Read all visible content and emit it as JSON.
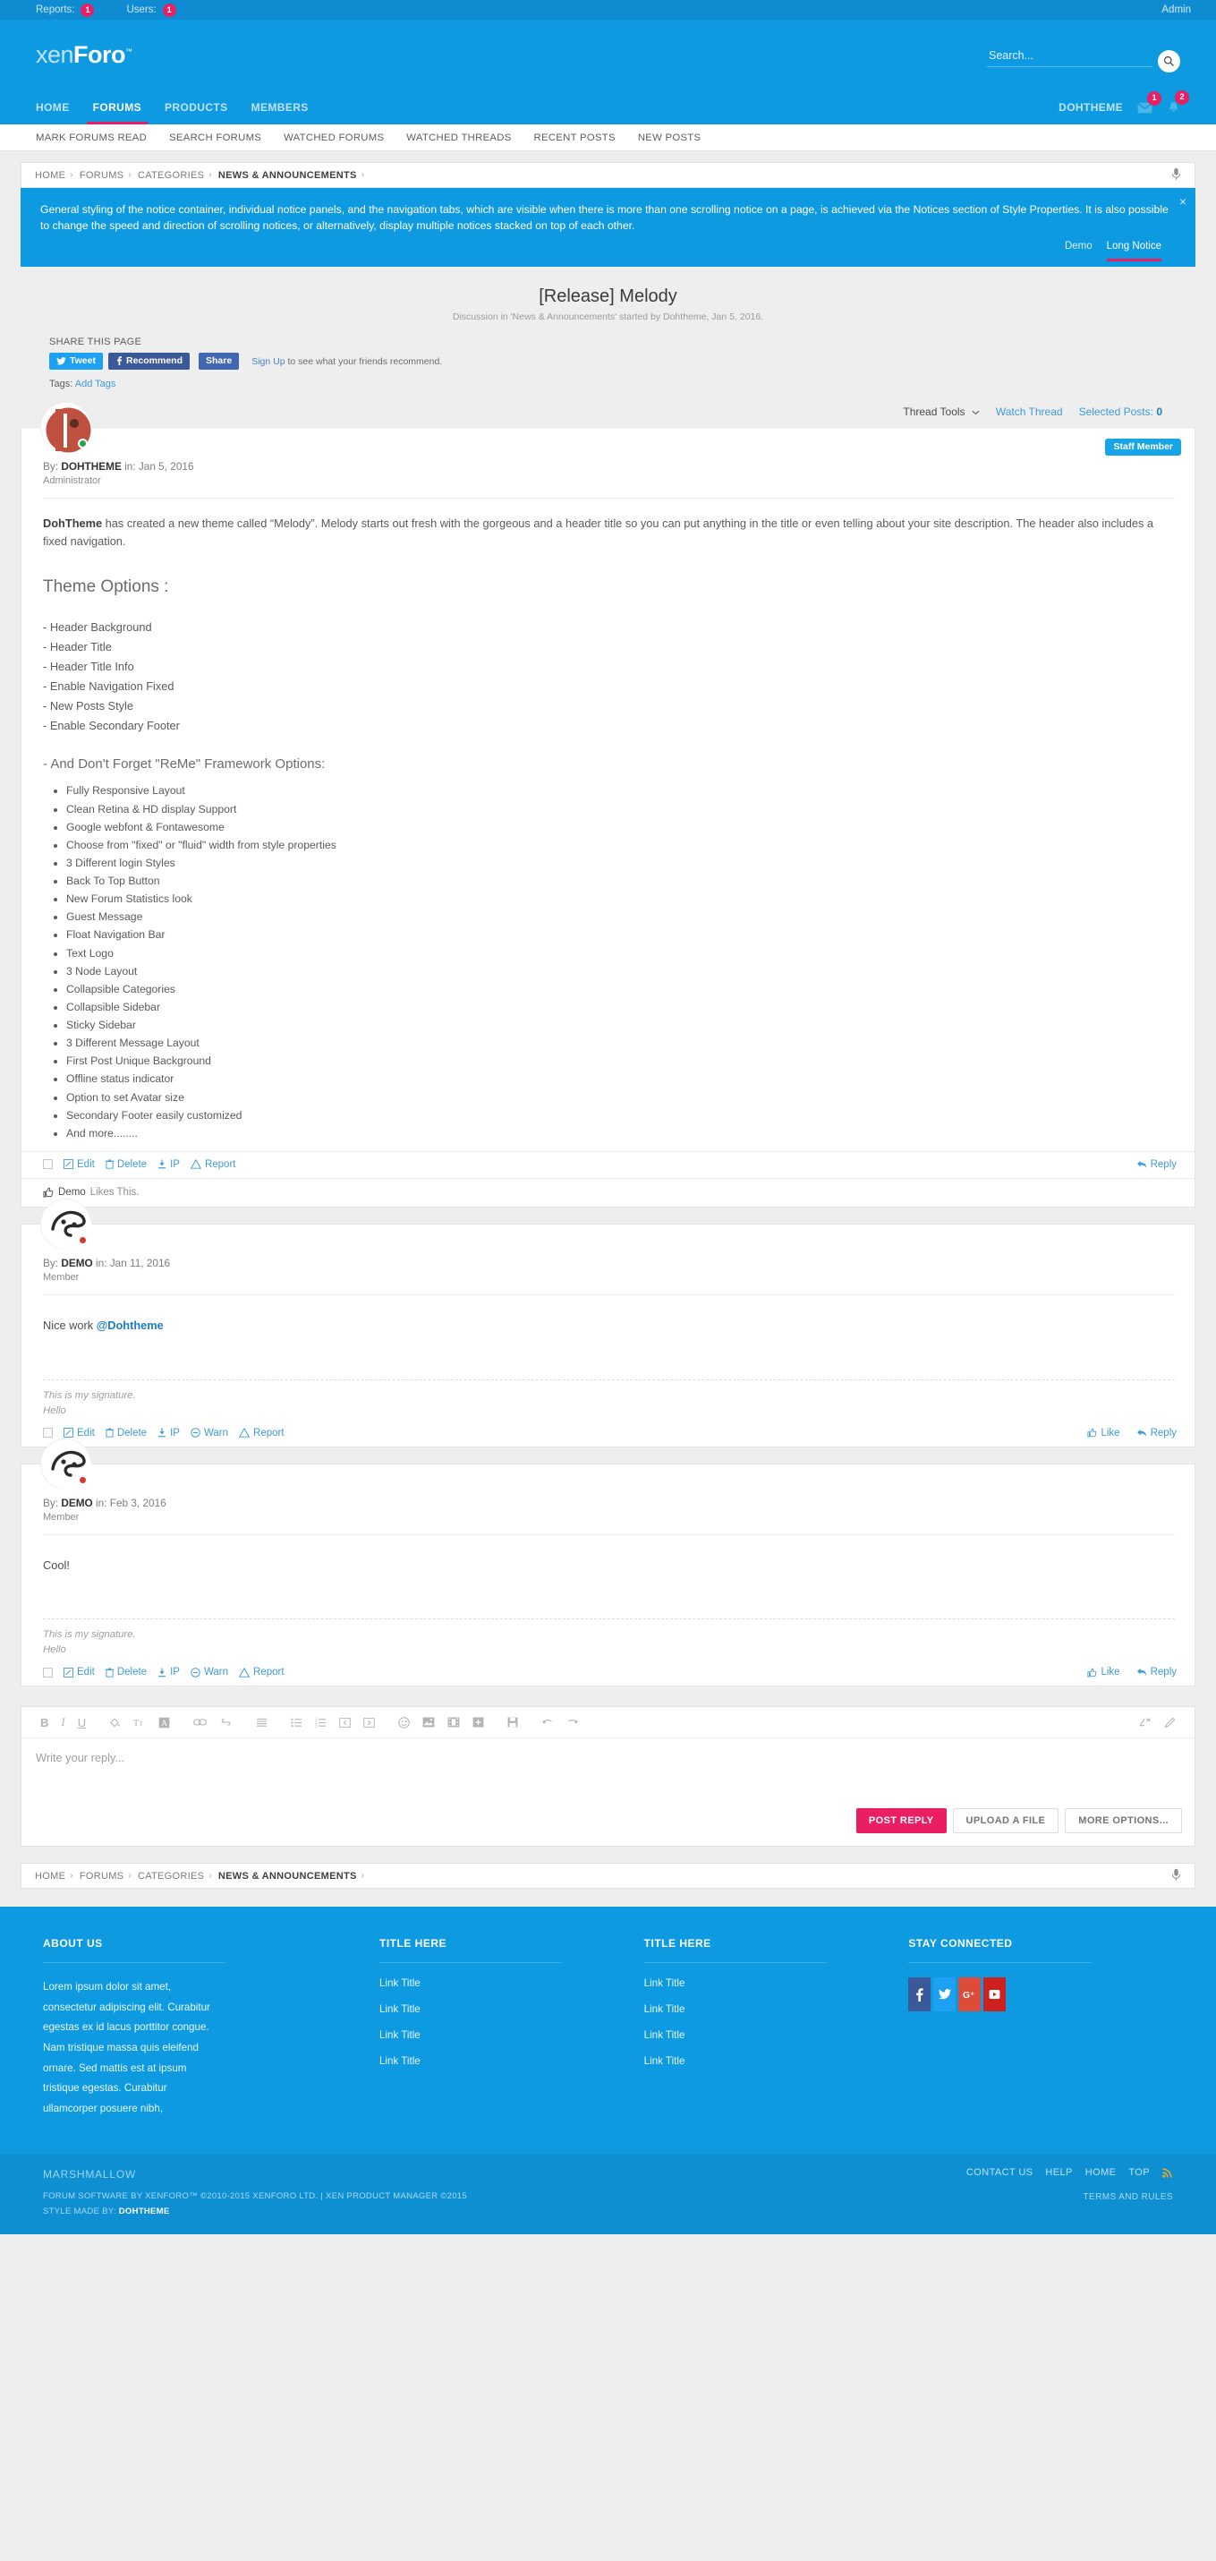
{
  "admin_bar": {
    "reports_label": "Reports:",
    "reports_count": "1",
    "users_label": "Users:",
    "users_count": "1",
    "admin_link": "Admin"
  },
  "header": {
    "logo_thin": "xen",
    "logo_bold": "Foro",
    "logo_tm": "™",
    "search_placeholder": "Search..."
  },
  "nav": {
    "tabs": [
      {
        "label": "HOME",
        "active": false
      },
      {
        "label": "FORUMS",
        "active": true
      },
      {
        "label": "PRODUCTS",
        "active": false
      },
      {
        "label": "MEMBERS",
        "active": false
      }
    ],
    "username": "DOHTHEME",
    "inbox_count": "1",
    "alerts_count": "2"
  },
  "subnav": {
    "items": [
      "MARK FORUMS READ",
      "SEARCH FORUMS",
      "WATCHED FORUMS",
      "WATCHED THREADS",
      "RECENT POSTS",
      "NEW POSTS"
    ]
  },
  "breadcrumb": {
    "items": [
      "HOME",
      "FORUMS",
      "CATEGORIES",
      "NEWS & ANNOUNCEMENTS"
    ],
    "separator": "›"
  },
  "notice": {
    "text": "General styling of the notice container, individual notice panels, and the navigation tabs, which are visible when there is more than one scrolling notice on a page, is achieved via the Notices section of Style Properties. It is also possible to change the speed and direction of scrolling notices, or alternatively, display multiple notices stacked on top of each other.",
    "close": "×",
    "tabs": [
      {
        "label": "Demo",
        "active": false
      },
      {
        "label": "Long Notice",
        "active": true
      }
    ]
  },
  "thread": {
    "title": "[Release] Melody",
    "subtitle": "Discussion in 'News & Announcements' started by Dohtheme, Jan 5, 2016.",
    "share_label": "SHARE THIS PAGE",
    "tweet_label": "Tweet",
    "recommend_label": "Recommend",
    "share_label_btn": "Share",
    "share_note_link": "Sign Up",
    "share_note_rest": " to see what your friends recommend.",
    "tags_label": "Tags:",
    "tags_link": "Add Tags",
    "thread_tools": "Thread Tools",
    "watch_thread": "Watch Thread",
    "selected_posts_label": "Selected Posts:",
    "selected_posts_count": "0"
  },
  "post1": {
    "by_label": "By:",
    "author": "DOHTHEME",
    "in_label": "in:",
    "date": "Jan 5, 2016",
    "role": "Administrator",
    "badge": "Staff Member",
    "intro_bold": "DohTheme",
    "intro_rest": " has created a new theme called “Melody”. Melody starts out fresh with the gorgeous and a header title so you can put anything in the title or even telling about your site description. The header also includes a fixed navigation.",
    "options_heading": "Theme Options :",
    "options": [
      "- Header Background",
      "- Header Title",
      "- Header Title Info",
      "- Enable Navigation Fixed",
      "- New Posts Style",
      "- Enable Secondary Footer"
    ],
    "framework_heading": "- And Don't Forget \"ReMe\" Framework Options:",
    "framework_items": [
      "Fully Responsive Layout",
      "Clean Retina & HD display Support",
      "Google webfont & Fontawesome",
      "Choose from \"fixed\" or \"fluid\" width from style properties",
      "3 Different login Styles",
      "Back To Top Button",
      "New Forum Statistics look",
      "Guest Message",
      "Float Navigation Bar",
      "Text Logo",
      "3 Node Layout",
      "Collapsible Categories",
      "Collapsible Sidebar",
      "Sticky Sidebar",
      "3 Different Message Layout",
      "First Post Unique Background",
      "Offline status indicator",
      "Option to set Avatar size",
      "Secondary Footer easily customized",
      "And more........"
    ],
    "actions": [
      "Edit",
      "Delete",
      "IP",
      "Report"
    ],
    "reply": "Reply",
    "likes_user": "Demo",
    "likes_text": "Likes This."
  },
  "post2": {
    "by_label": "By:",
    "author": "DEMO",
    "in_label": "in:",
    "date": "Jan 11, 2016",
    "role": "Member",
    "message_plain": "Nice work ",
    "message_mention": "@Dohtheme",
    "signature_line1": "This is my signature.",
    "signature_line2": "Hello",
    "actions": [
      "Edit",
      "Delete",
      "IP",
      "Warn",
      "Report"
    ],
    "like": "Like",
    "reply": "Reply"
  },
  "post3": {
    "by_label": "By:",
    "author": "DEMO",
    "in_label": "in:",
    "date": "Feb 3, 2016",
    "role": "Member",
    "message_plain": "Cool!",
    "message_mention": "",
    "signature_line1": "This is my signature.",
    "signature_line2": "Hello",
    "actions": [
      "Edit",
      "Delete",
      "IP",
      "Warn",
      "Report"
    ],
    "like": "Like",
    "reply": "Reply"
  },
  "editor": {
    "placeholder": "Write your reply...",
    "post_reply": "POST REPLY",
    "upload_file": "UPLOAD A FILE",
    "more_options": "MORE OPTIONS..."
  },
  "footer": {
    "col1_title": "ABOUT US",
    "col1_text": "Lorem ipsum dolor sit amet, consectetur adipiscing elit. Curabitur egestas ex id lacus porttitor congue. Nam tristique massa quis eleifend ornare. Sed mattis est at ipsum tristique egestas. Curabitur ullamcorper posuere nibh,",
    "col2_title": "TITLE HERE",
    "col2_links": [
      "Link Title",
      "Link Title",
      "Link Title",
      "Link Title"
    ],
    "col3_title": "TITLE HERE",
    "col3_links": [
      "Link Title",
      "Link Title",
      "Link Title",
      "Link Title"
    ],
    "col4_title": "STAY CONNECTED",
    "socials": [
      "facebook",
      "twitter",
      "google-plus",
      "youtube"
    ]
  },
  "footer_bottom": {
    "brand": "MARSHMALLOW",
    "links": [
      "CONTACT US",
      "HELP",
      "HOME",
      "TOP"
    ],
    "rss": "ᴿ",
    "copyright_line1": "FORUM SOFTWARE BY XENFORO™ ©2010-2015 XENFORO LTD. | XEN PRODUCT MANAGER ©2015",
    "copyright_line2_label": "STYLE MADE BY:",
    "copyright_line2_brand": "DOHTHEME",
    "terms": "TERMS AND RULES"
  }
}
